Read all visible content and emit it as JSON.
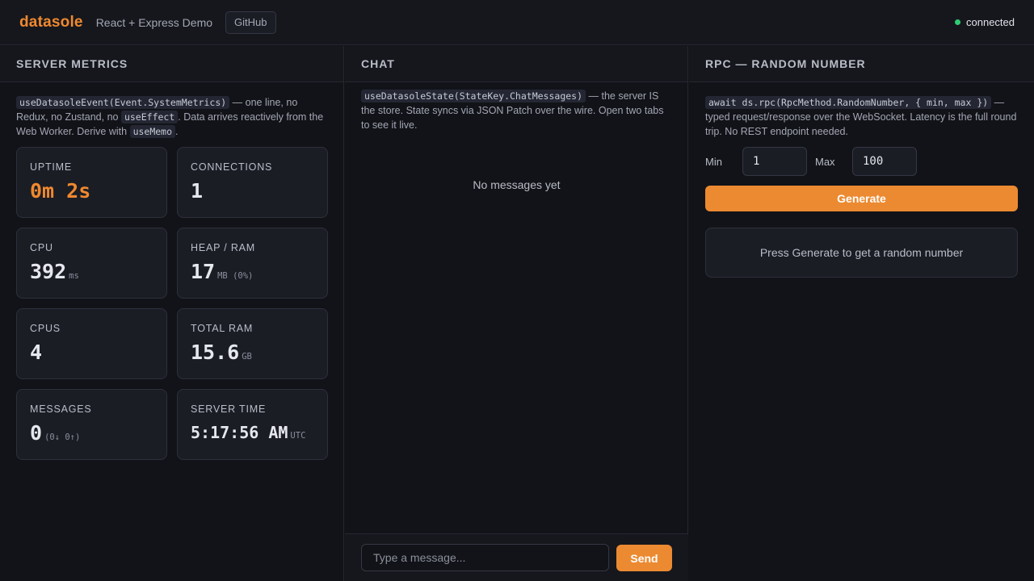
{
  "header": {
    "brand": "datasole",
    "subtitle": "React + Express Demo",
    "github_label": "GitHub",
    "status_text": "connected"
  },
  "metrics": {
    "title": "SERVER METRICS",
    "desc": {
      "code1": "useDatasoleEvent(Event.SystemMetrics)",
      "text1": " — one line, no Redux, no Zustand, no ",
      "code2": "useEffect",
      "text2": ". Data arrives reactively from the Web Worker. Derive with ",
      "code3": "useMemo",
      "text3": "."
    },
    "cards": [
      {
        "label": "UPTIME",
        "value": "0m 2s",
        "unit": ""
      },
      {
        "label": "CONNECTIONS",
        "value": "1",
        "unit": ""
      },
      {
        "label": "CPU",
        "value": "392",
        "unit": "ms"
      },
      {
        "label": "HEAP / RAM",
        "value": "17",
        "unit": "MB (0%)"
      },
      {
        "label": "CPUS",
        "value": "4",
        "unit": ""
      },
      {
        "label": "TOTAL RAM",
        "value": "15.6",
        "unit": "GB"
      },
      {
        "label": "MESSAGES",
        "value": "0",
        "unit": "(0↓ 0↑)"
      },
      {
        "label": "SERVER TIME",
        "value": "5:17:56 AM",
        "unit": "UTC"
      }
    ]
  },
  "chat": {
    "title": "CHAT",
    "desc": {
      "code1": "useDatasoleState(StateKey.ChatMessages)",
      "text1": " — the server IS the store. State syncs via JSON Patch over the wire. Open two tabs to see it live."
    },
    "empty_text": "No messages yet",
    "input_placeholder": "Type a message...",
    "send_label": "Send"
  },
  "rpc": {
    "title": "RPC — RANDOM NUMBER",
    "desc": {
      "code1": "await ds.rpc(RpcMethod.RandomNumber, { min, max })",
      "text1": " — typed request/response over the WebSocket. Latency is the full round trip. No REST endpoint needed."
    },
    "min_label": "Min",
    "min_value": "1",
    "max_label": "Max",
    "max_value": "100",
    "generate_label": "Generate",
    "result_text": "Press Generate to get a random number"
  },
  "colors": {
    "accent": "#f0892e",
    "status_ok": "#2ecc71",
    "background": "#121318"
  }
}
